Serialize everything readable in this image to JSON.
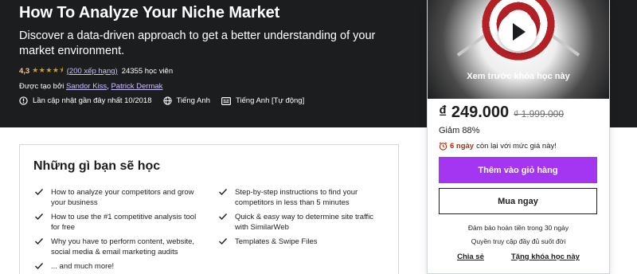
{
  "course": {
    "title": "How To Analyze Your Niche Market",
    "subtitle": "Discover a data-driven approach to get a better understanding of your market environment.",
    "rating": "4,3",
    "stars": "★★★★⯨",
    "rating_count": "(200 xếp hạng)",
    "students": "24355 học viên",
    "created_by_label": "Được tạo bởi",
    "creators": [
      "Sandor Kiss",
      "Patrick Dermak"
    ],
    "last_updated": "Lần cập nhật gần đây nhất 10/2018",
    "language": "Tiếng Anh",
    "captions": "Tiếng Anh [Tự động]"
  },
  "sidebar": {
    "preview_label": "Xem trước khóa học này",
    "price": "₫ 249.000",
    "original_price": "₫ 1.999.000",
    "discount": "Giảm 88%",
    "timer_bold": "6 ngày",
    "timer_rest": "còn lại với mức giá này!",
    "add_to_cart": "Thêm vào giỏ hàng",
    "buy_now": "Mua ngay",
    "guarantee": "Đảm bảo hoàn tiền trong 30 ngày",
    "lifetime": "Quyền truy cập đầy đủ suốt đời",
    "share": "Chia sẻ",
    "gift": "Tặng khóa học này"
  },
  "learn": {
    "title": "Những gì bạn sẽ học",
    "left": [
      "How to analyze your competitors and grow your business",
      "How to use the #1 competitive analysis tool for free",
      "Why you have to perform content, website, social media & email marketing audits",
      "... and much more!"
    ],
    "right": [
      "Step-by-step instructions to find your competitors in less than 5 minutes",
      "Quick & easy way to determine site traffic with SimilarWeb",
      "Templates & Swipe Files"
    ]
  },
  "colors": {
    "hero_bg": "#1c1d1f",
    "accent_purple": "#a435f0",
    "star": "#e59819",
    "link": "#cec0fc",
    "alert": "#b32d0f"
  }
}
